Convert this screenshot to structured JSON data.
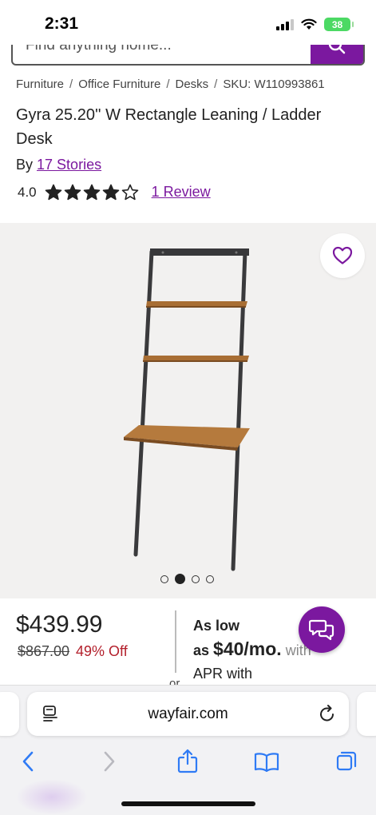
{
  "status_bar": {
    "time": "2:31",
    "battery": "38"
  },
  "search": {
    "placeholder": "Find anything home..."
  },
  "breadcrumb": {
    "items": [
      "Furniture",
      "Office Furniture",
      "Desks"
    ],
    "sku": "SKU: W110993861"
  },
  "product": {
    "title": "Gyra 25.20'' W Rectangle Leaning / Ladder Desk",
    "by_label": "By",
    "brand": "17 Stories",
    "rating": "4.0",
    "rating_value": 4,
    "rating_max": 5,
    "review_link": "1 Review"
  },
  "gallery": {
    "image_count": 4,
    "active_index": 1
  },
  "pricing": {
    "price": "$439.99",
    "old_price": "$867.00",
    "discount": "49% Off",
    "financing_line1": "As low",
    "financing_as": "as",
    "financing_amount": "$40/mo.",
    "financing_faded": "with",
    "financing_line3": "APR with",
    "or_label": "or"
  },
  "browser": {
    "url": "wayfair.com"
  },
  "colors": {
    "brand_purple": "#7b189f",
    "discount_red": "#b3202c",
    "image_bg": "#f2f1f0"
  },
  "icons": [
    "search-icon",
    "heart-icon",
    "star-icon",
    "chat-icon",
    "reader-icon",
    "reload-icon",
    "back-icon",
    "forward-icon",
    "share-icon",
    "bookmarks-icon",
    "tabs-icon"
  ]
}
